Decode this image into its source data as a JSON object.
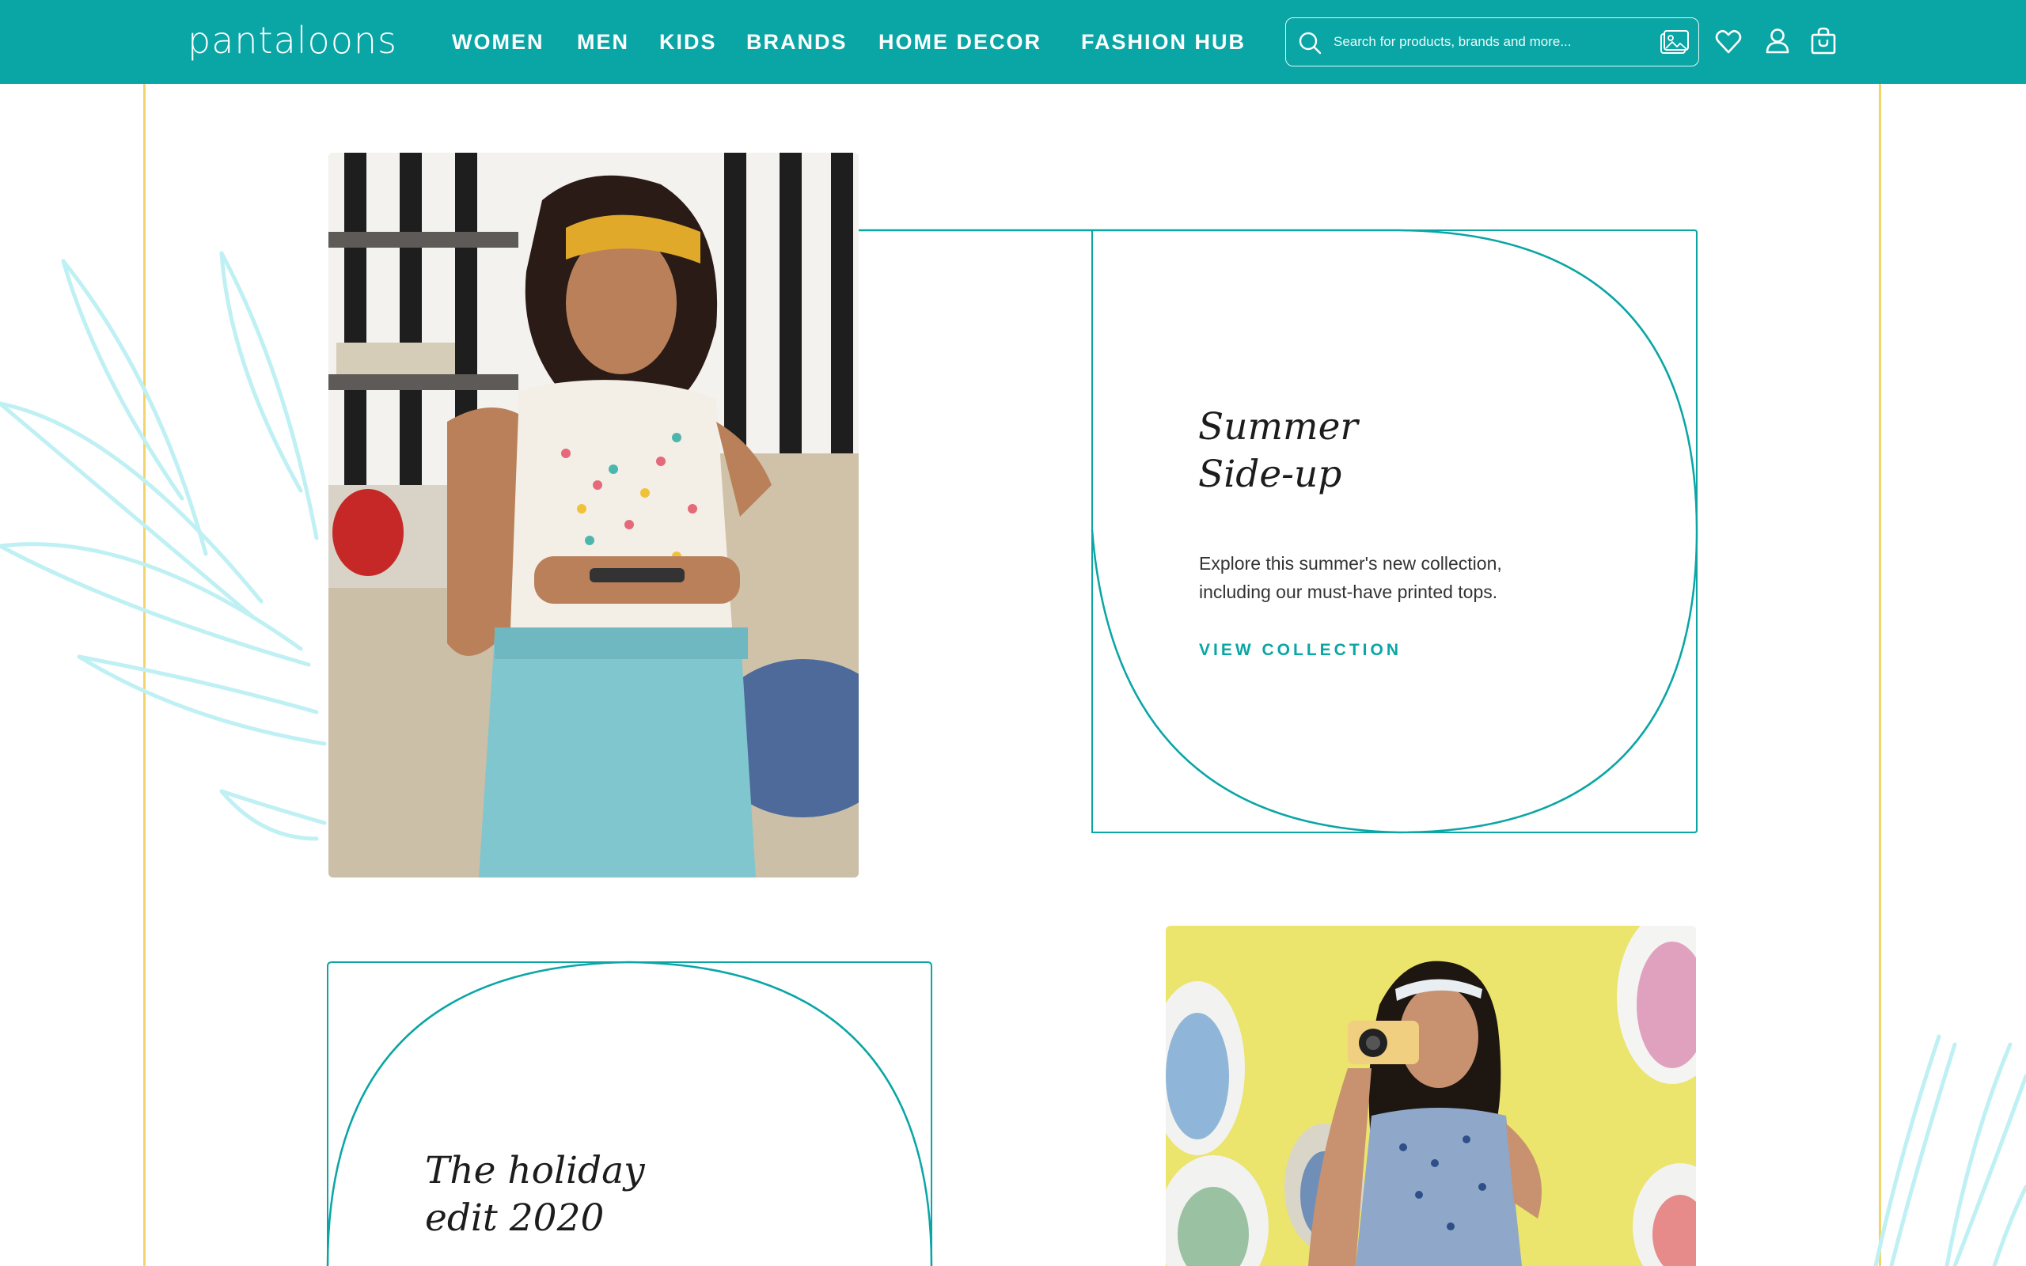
{
  "header": {
    "logo_text": "pantaloons",
    "nav": [
      {
        "label": "WOMEN"
      },
      {
        "label": "MEN"
      },
      {
        "label": "KIDS"
      },
      {
        "label": "BRANDS"
      },
      {
        "label": "HOME DECOR"
      },
      {
        "label": "FASHION HUB"
      }
    ],
    "search": {
      "placeholder": "Search for products, brands and more..."
    },
    "icons": {
      "search": "search-icon",
      "camera": "image-search-icon",
      "wishlist": "heart-tag-icon",
      "account": "user-icon",
      "bag": "shopping-bag-icon"
    }
  },
  "sections": [
    {
      "title_line1": "Summer",
      "title_line2": "Side-up",
      "description": "Explore this summer's new collection, including our must-have printed tops.",
      "cta": "VIEW COLLECTION",
      "image": "woman-in-printed-top-with-phone"
    },
    {
      "title_line1": "The holiday",
      "title_line2": "edit 2020",
      "image": "girl-with-camera-yellow-background"
    }
  ],
  "colors": {
    "brand": "#0aa5a5",
    "guide_lines": "#f2d56a",
    "leaves": "#bff0f4",
    "text": "#1c1c1c"
  }
}
